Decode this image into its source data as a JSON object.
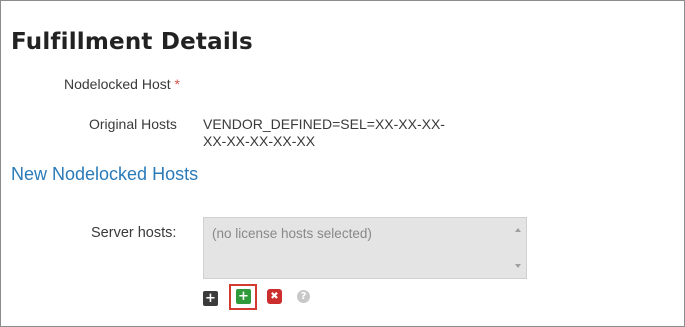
{
  "page": {
    "title": "Fulfillment Details",
    "nodelocked_label": "Nodelocked Host",
    "required_marker": "*",
    "original_hosts_label": "Original Hosts",
    "original_hosts_line1": "VENDOR_DEFINED=SEL=XX-XX-XX-",
    "original_hosts_line2": "XX-XX-XX-XX-XX",
    "new_section_title": "New Nodelocked Hosts",
    "server_hosts_label": "Server hosts:",
    "server_hosts_placeholder": "(no license hosts selected)"
  },
  "toolbar": {
    "add_icon_glyph": "+",
    "add_green_glyph": "+",
    "remove_glyph": "✖",
    "help_glyph": "?"
  },
  "colors": {
    "title": "#222222",
    "link_blue": "#2a7ab8",
    "required_red": "#d9534f",
    "add_green": "#2f9a3a",
    "remove_red": "#cc2d2d",
    "highlight_red": "#d23b2f"
  }
}
